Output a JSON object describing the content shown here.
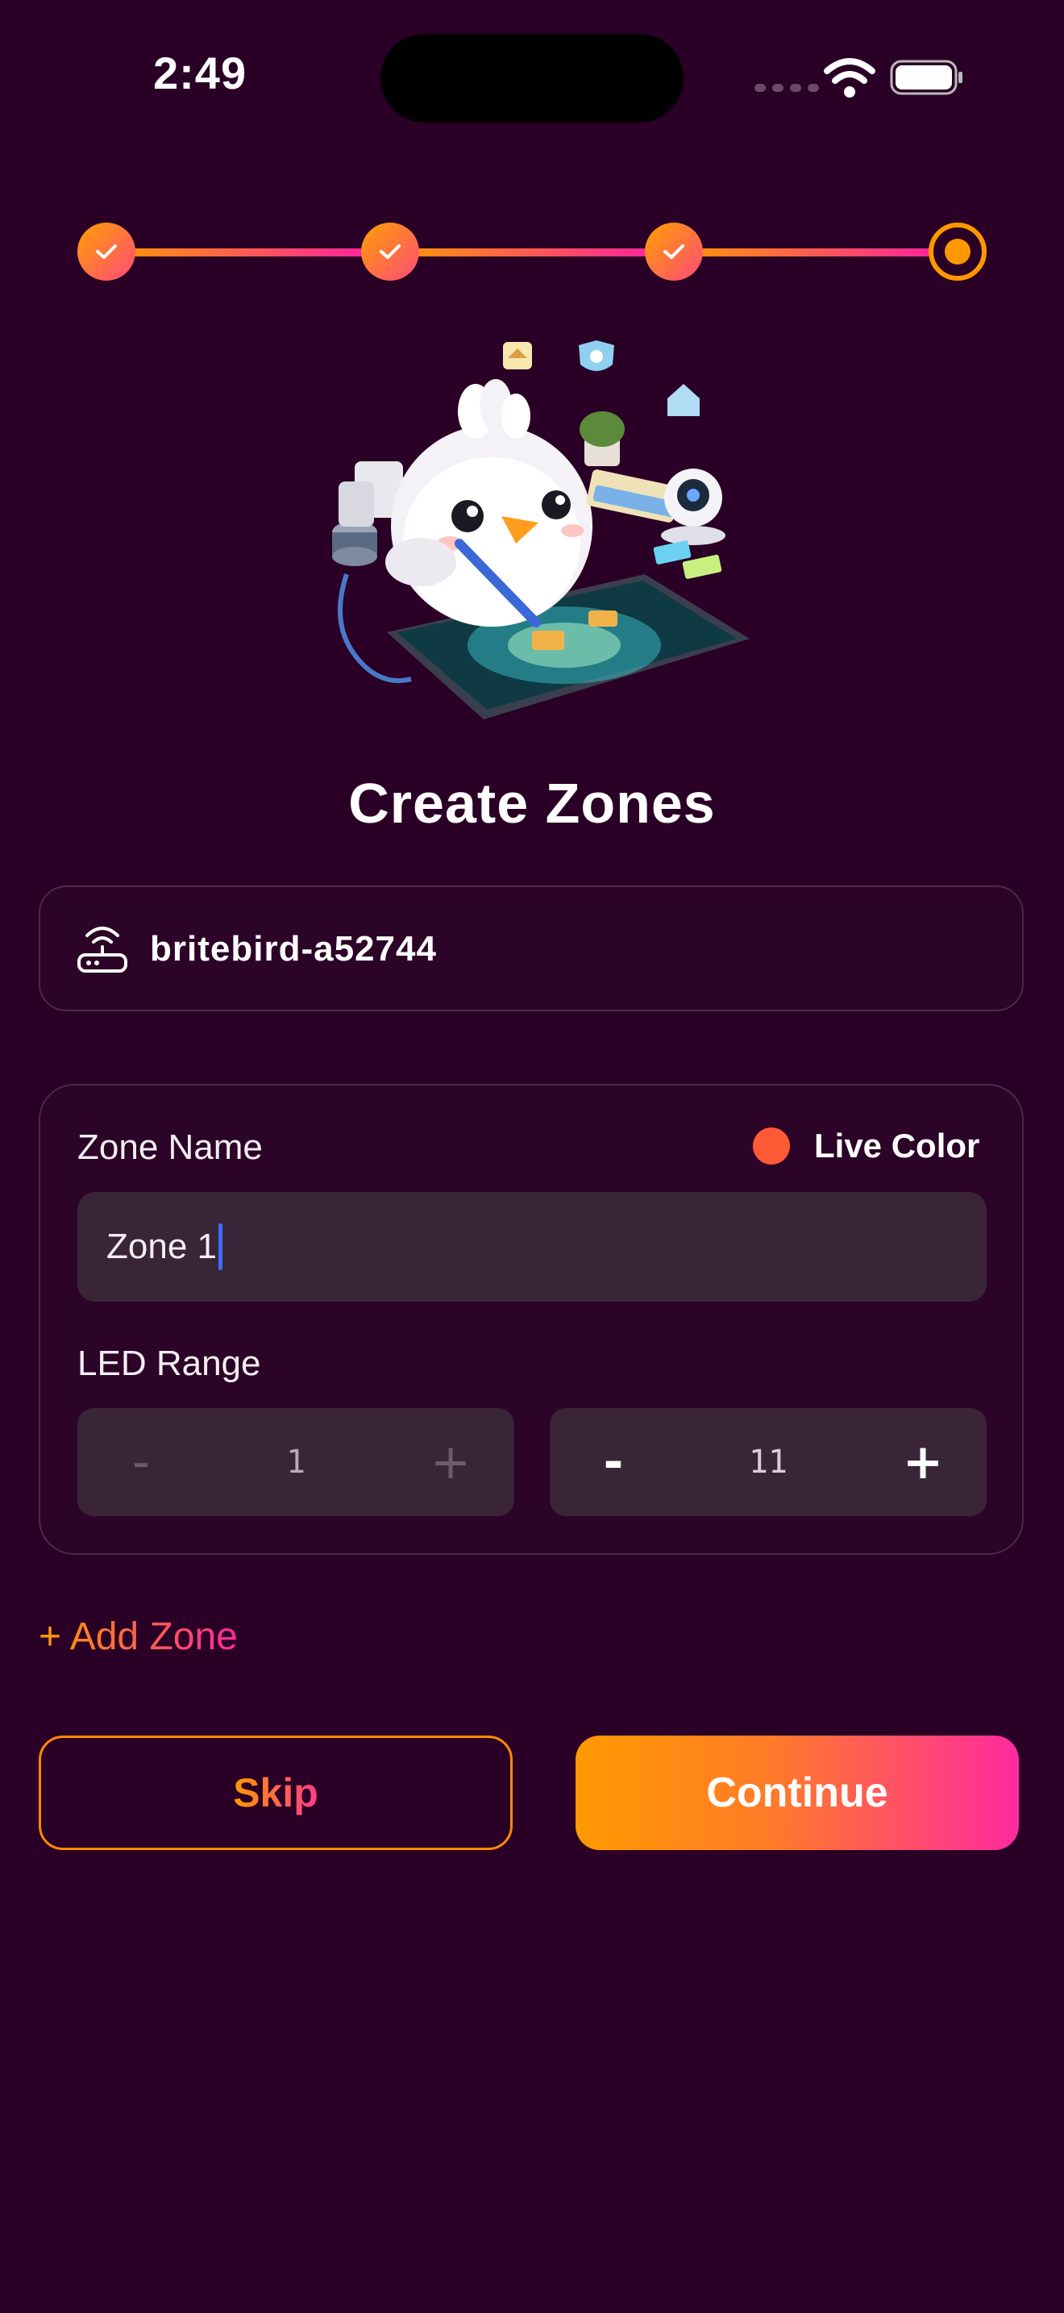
{
  "status_bar": {
    "time": "2:49"
  },
  "stepper": {
    "total_steps": 4,
    "completed_steps": 3,
    "current_step": 4
  },
  "page": {
    "title": "Create Zones"
  },
  "device": {
    "icon": "router-icon",
    "name": "britebird-a52744"
  },
  "zone": {
    "name_label": "Zone Name",
    "name_value": "Zone 1",
    "live_color_label": "Live Color",
    "live_color": "#ff5a36",
    "led_range_label": "LED Range",
    "range_start": {
      "minus": "-",
      "value": "1",
      "plus": "+",
      "enabled": false
    },
    "range_end": {
      "minus": "-",
      "value": "11",
      "plus": "+",
      "enabled": true
    }
  },
  "actions": {
    "add_zone": "+ Add Zone",
    "skip": "Skip",
    "continue": "Continue"
  },
  "colors": {
    "background": "#2a0026",
    "accent_start": "#ff9a00",
    "accent_end": "#ff2aa0",
    "caret": "#3c6cff"
  }
}
